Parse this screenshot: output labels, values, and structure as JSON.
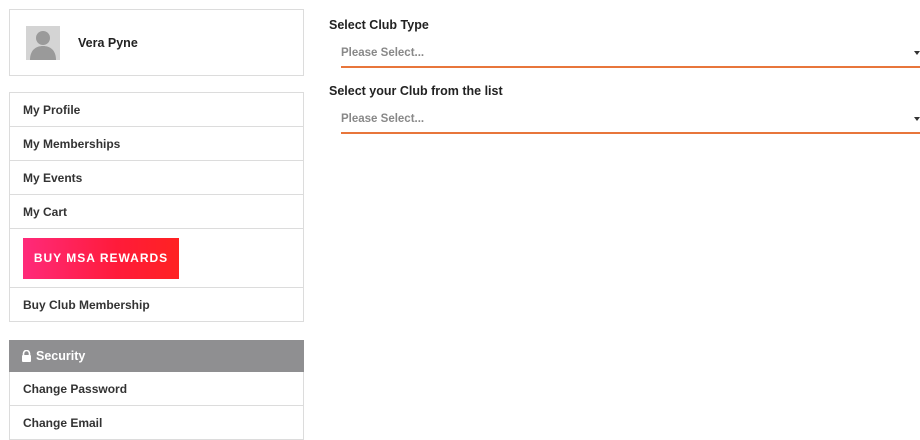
{
  "profile": {
    "name": "Vera Pyne",
    "avatar_icon": "person-silhouette-icon"
  },
  "menu": {
    "items": [
      {
        "label": "My Profile"
      },
      {
        "label": "My Memberships"
      },
      {
        "label": "My Events"
      },
      {
        "label": "My Cart"
      }
    ],
    "promo_label": "BUY MSA REWARDS",
    "buy_club_label": "Buy Club Membership"
  },
  "security": {
    "header_label": "Security",
    "header_icon": "lock-icon",
    "items": [
      {
        "label": "Change Password"
      },
      {
        "label": "Change Email"
      }
    ]
  },
  "form": {
    "club_type": {
      "label": "Select Club Type",
      "value": "Please Select..."
    },
    "club": {
      "label": "Select your Club from the list",
      "value": "Please Select..."
    }
  },
  "colors": {
    "accent_underline": "#e8763b",
    "promo_gradient_start": "#ff2a7a",
    "promo_gradient_end": "#ff2222",
    "security_header_bg": "#8f8f91"
  }
}
